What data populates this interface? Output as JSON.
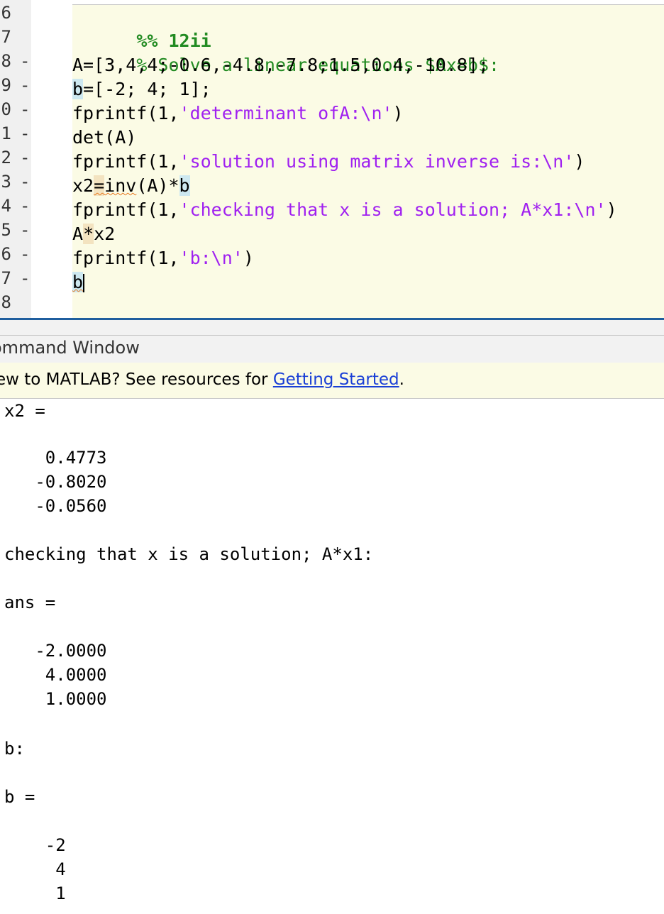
{
  "editor": {
    "gutter": [
      {
        "num": "6",
        "dash": ""
      },
      {
        "num": "7",
        "dash": ""
      },
      {
        "num": "8",
        "dash": "-"
      },
      {
        "num": "9",
        "dash": "-"
      },
      {
        "num": "0",
        "dash": "-"
      },
      {
        "num": "1",
        "dash": "-"
      },
      {
        "num": "2",
        "dash": "-"
      },
      {
        "num": "3",
        "dash": "-"
      },
      {
        "num": "4",
        "dash": "-"
      },
      {
        "num": "5",
        "dash": "-"
      },
      {
        "num": "6",
        "dash": "-"
      },
      {
        "num": "7",
        "dash": "-"
      },
      {
        "num": "8",
        "dash": ""
      }
    ],
    "lines": {
      "l0_cell": "%% 12ii",
      "l1_comment": "% Solve a linear equations $Ax=b$:",
      "l2": "A=[3,4,4;-0.6,-4.8,-7.8;1.5,0.4,-10.8];",
      "l3_b": "b",
      "l3_rest": "=[-2; 4; 1];",
      "l4_a": "fprintf(1,",
      "l4_s": "'determinant ofA:\\n'",
      "l4_c": ")",
      "l5": "det(A)",
      "l6_a": "fprintf(1,",
      "l6_s": "'solution using matrix inverse is:\\n'",
      "l6_c": ")",
      "l7_a": "x2",
      "l7_eq": "=",
      "l7_inv": "inv",
      "l7_mid": "(A)*",
      "l7_b": "b",
      "l8_a": "fprintf(1,",
      "l8_s": "'checking that x is a solution; A*x1:\\n'",
      "l8_c": ")",
      "l9_a": "A",
      "l9_star": "*",
      "l9_b": "x2",
      "l10_a": "fprintf(1,",
      "l10_s": "'b:\\n'",
      "l10_c": ")",
      "l11_b": "b"
    }
  },
  "command_window": {
    "title": "ommand Window",
    "banner_prefix": "ew to MATLAB? See resources for ",
    "banner_link": "Getting Started",
    "banner_suffix": ".",
    "output": [
      "x2 =",
      "",
      "    0.4773",
      "   -0.8020",
      "   -0.0560",
      "",
      "checking that x is a solution; A*x1:",
      "",
      "ans =",
      "",
      "   -2.0000",
      "    4.0000",
      "    1.0000",
      "",
      "",
      "b:",
      "",
      "b =",
      "",
      "",
      "    -2",
      "     4",
      "     1"
    ]
  }
}
